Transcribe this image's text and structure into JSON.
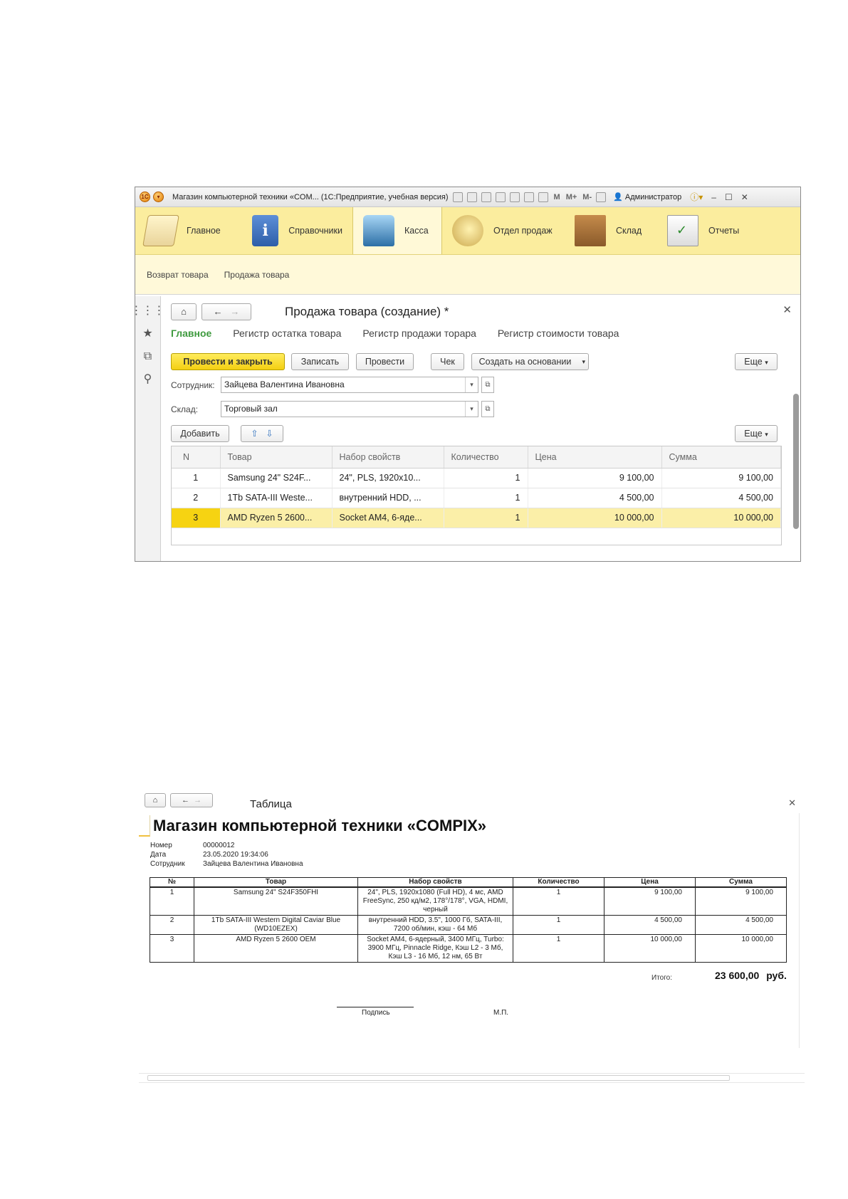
{
  "window1": {
    "title": "Магазин компьютерной техники «COM... (1С:Предприятие, учебная версия)",
    "toolbar_m": "M",
    "toolbar_mplus": "M+",
    "toolbar_mminus": "M-",
    "user": "Администратор",
    "sections": [
      {
        "label": "Главное",
        "icon": "desk-lamp-icon"
      },
      {
        "label": "Справочники",
        "icon": "info-book-icon"
      },
      {
        "label": "Касса",
        "icon": "cash-register-icon"
      },
      {
        "label": "Отдел продаж",
        "icon": "coins-chart-icon"
      },
      {
        "label": "Склад",
        "icon": "boxes-icon"
      },
      {
        "label": "Отчеты",
        "icon": "checklist-icon"
      }
    ],
    "subsections": [
      "Возврат товара",
      "Продажа товара"
    ],
    "form": {
      "title": "Продажа товара (создание) *",
      "tabs": [
        "Главное",
        "Регистр остатка товара",
        "Регистр продажи торара",
        "Регистр стоимости товара"
      ],
      "buttons": {
        "post_close": "Провести и закрыть",
        "write": "Записать",
        "post": "Провести",
        "check": "Чек",
        "create_based": "Создать на основании",
        "more": "Еще",
        "add": "Добавить"
      },
      "employee_label": "Сотрудник:",
      "employee_value": "Зайцева Валентина Ивановна",
      "warehouse_label": "Склад:",
      "warehouse_value": "Торговый зал",
      "table": {
        "headers": [
          "N",
          "Товар",
          "Набор свойств",
          "Количество",
          "Цена",
          "Сумма"
        ],
        "rows": [
          [
            "1",
            "Samsung 24\" S24F...",
            "24\", PLS, 1920x10...",
            "1",
            "9 100,00",
            "9 100,00"
          ],
          [
            "2",
            "1Tb SATA-III Weste...",
            "внутренний HDD, ...",
            "1",
            "4 500,00",
            "4 500,00"
          ],
          [
            "3",
            "AMD Ryzen 5 2600...",
            "Socket AM4, 6-яде...",
            "1",
            "10 000,00",
            "10 000,00"
          ]
        ]
      }
    }
  },
  "window2": {
    "title": "Таблица",
    "report_title": "Магазин компьютерной техники «COMPIX»",
    "meta": [
      {
        "label": "Номер",
        "value": "00000012"
      },
      {
        "label": "Дата",
        "value": "23.05.2020 19:34:06"
      },
      {
        "label": "Сотрудник",
        "value": "Зайцева Валентина Ивановна"
      }
    ],
    "table": {
      "headers": [
        "№",
        "Товар",
        "Набор свойств",
        "Количество",
        "Цена",
        "Сумма"
      ],
      "rows": [
        [
          "1",
          "Samsung 24\" S24F350FHI",
          "24\", PLS, 1920x1080 (Full HD), 4 мс, AMD FreeSync, 250 кд/м2, 178°/178°, VGA, HDMI, черный",
          "1",
          "9 100,00",
          "9 100,00"
        ],
        [
          "2",
          "1Tb SATA-III Western Digital Caviar Blue (WD10EZEX)",
          "внутренний HDD, 3.5\", 1000 Гб, SATA-III, 7200 об/мин, кэш - 64 Мб",
          "1",
          "4 500,00",
          "4 500,00"
        ],
        [
          "3",
          "AMD Ryzen 5 2600 OEM",
          "Socket AM4, 6-ядерный, 3400 МГц, Turbo: 3900 МГц, Pinnacle Ridge, Кэш L2 - 3 Мб, Кэш L3 - 16 Мб, 12 нм, 65 Вт",
          "1",
          "10 000,00",
          "10 000,00"
        ]
      ]
    },
    "total_label": "Итого:",
    "total_value": "23 600,00",
    "currency": "руб.",
    "sign_label": "Подпись",
    "stamp_label": "М.П."
  }
}
